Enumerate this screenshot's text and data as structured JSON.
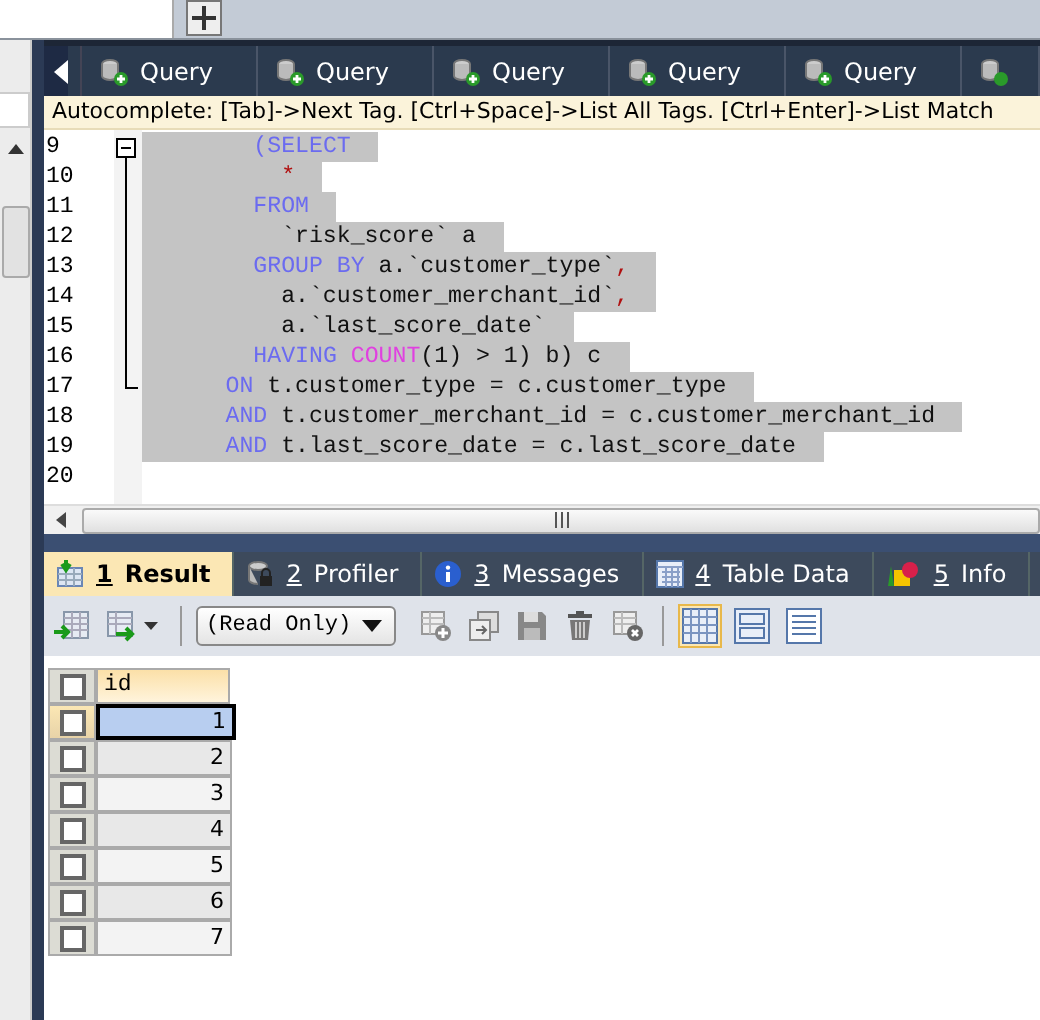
{
  "query_tabs": [
    {
      "label": "Query",
      "selected": false
    },
    {
      "label": "Query",
      "selected": false
    },
    {
      "label": "Query",
      "selected": false
    },
    {
      "label": "Query",
      "selected": false
    },
    {
      "label": "Query",
      "selected": false
    }
  ],
  "autocomplete_hint": "Autocomplete: [Tab]->Next Tag. [Ctrl+Space]->List All Tags. [Ctrl+Enter]->List Match",
  "editor": {
    "lines": [
      {
        "number": "9",
        "selected": true,
        "kind": "clause",
        "tokens": [
          {
            "kind": "keyword",
            "text": "(SELECT"
          }
        ]
      },
      {
        "number": "10",
        "selected": true,
        "kind": "body",
        "tokens": [
          {
            "kind": "operator",
            "text": "*"
          }
        ]
      },
      {
        "number": "11",
        "selected": true,
        "kind": "clause",
        "tokens": [
          {
            "kind": "keyword",
            "text": "FROM"
          }
        ]
      },
      {
        "number": "12",
        "selected": true,
        "kind": "body",
        "tokens": [
          {
            "kind": "ident",
            "text": "`risk_score` a"
          }
        ]
      },
      {
        "number": "13",
        "selected": true,
        "kind": "clause",
        "tokens": [
          {
            "kind": "keyword",
            "text": "GROUP BY"
          },
          {
            "kind": "ident",
            "text": " a.`customer_type`"
          },
          {
            "kind": "operator",
            "text": ","
          }
        ]
      },
      {
        "number": "14",
        "selected": true,
        "kind": "body",
        "tokens": [
          {
            "kind": "ident",
            "text": "a.`customer_merchant_id`"
          },
          {
            "kind": "operator",
            "text": ","
          }
        ]
      },
      {
        "number": "15",
        "selected": true,
        "kind": "body",
        "tokens": [
          {
            "kind": "ident",
            "text": "a.`last_score_date`"
          }
        ]
      },
      {
        "number": "16",
        "selected": true,
        "kind": "clause",
        "tokens": [
          {
            "kind": "keyword",
            "text": "HAVING"
          },
          {
            "kind": "function",
            "text": " COUNT"
          },
          {
            "kind": "ident",
            "text": "(1) > 1) b) c"
          }
        ]
      },
      {
        "number": "17",
        "selected": true,
        "kind": "join",
        "tokens": [
          {
            "kind": "keyword",
            "text": "ON"
          },
          {
            "kind": "ident",
            "text": " t.customer_type = c.customer_type"
          }
        ]
      },
      {
        "number": "18",
        "selected": true,
        "kind": "join",
        "tokens": [
          {
            "kind": "keyword",
            "text": "AND"
          },
          {
            "kind": "ident",
            "text": " t.customer_merchant_id = c.customer_merchant_id"
          }
        ]
      },
      {
        "number": "19",
        "selected": true,
        "kind": "join",
        "tokens": [
          {
            "kind": "keyword",
            "text": "AND"
          },
          {
            "kind": "ident",
            "text": " t.last_score_date = c.last_score_date"
          }
        ]
      },
      {
        "number": "20"
      }
    ]
  },
  "result_tabs": [
    {
      "number": "1",
      "label": "Result",
      "selected": true
    },
    {
      "number": "2",
      "label": "Profiler",
      "selected": false
    },
    {
      "number": "3",
      "label": "Messages",
      "selected": false
    },
    {
      "number": "4",
      "label": "Table Data",
      "selected": false
    },
    {
      "number": "5",
      "label": "Info",
      "selected": false
    }
  ],
  "toolbar": {
    "mode_dropdown": "(Read Only)"
  },
  "grid": {
    "columns": [
      "id"
    ],
    "all_checked": false,
    "rows": [
      {
        "id": "1",
        "selected": true,
        "checked": false
      },
      {
        "id": "2",
        "selected": false,
        "checked": false
      },
      {
        "id": "3",
        "selected": false,
        "checked": false
      },
      {
        "id": "4",
        "selected": false,
        "checked": false
      },
      {
        "id": "5",
        "selected": false,
        "checked": false
      },
      {
        "id": "6",
        "selected": false,
        "checked": false
      },
      {
        "id": "7",
        "selected": false,
        "checked": false
      }
    ]
  }
}
